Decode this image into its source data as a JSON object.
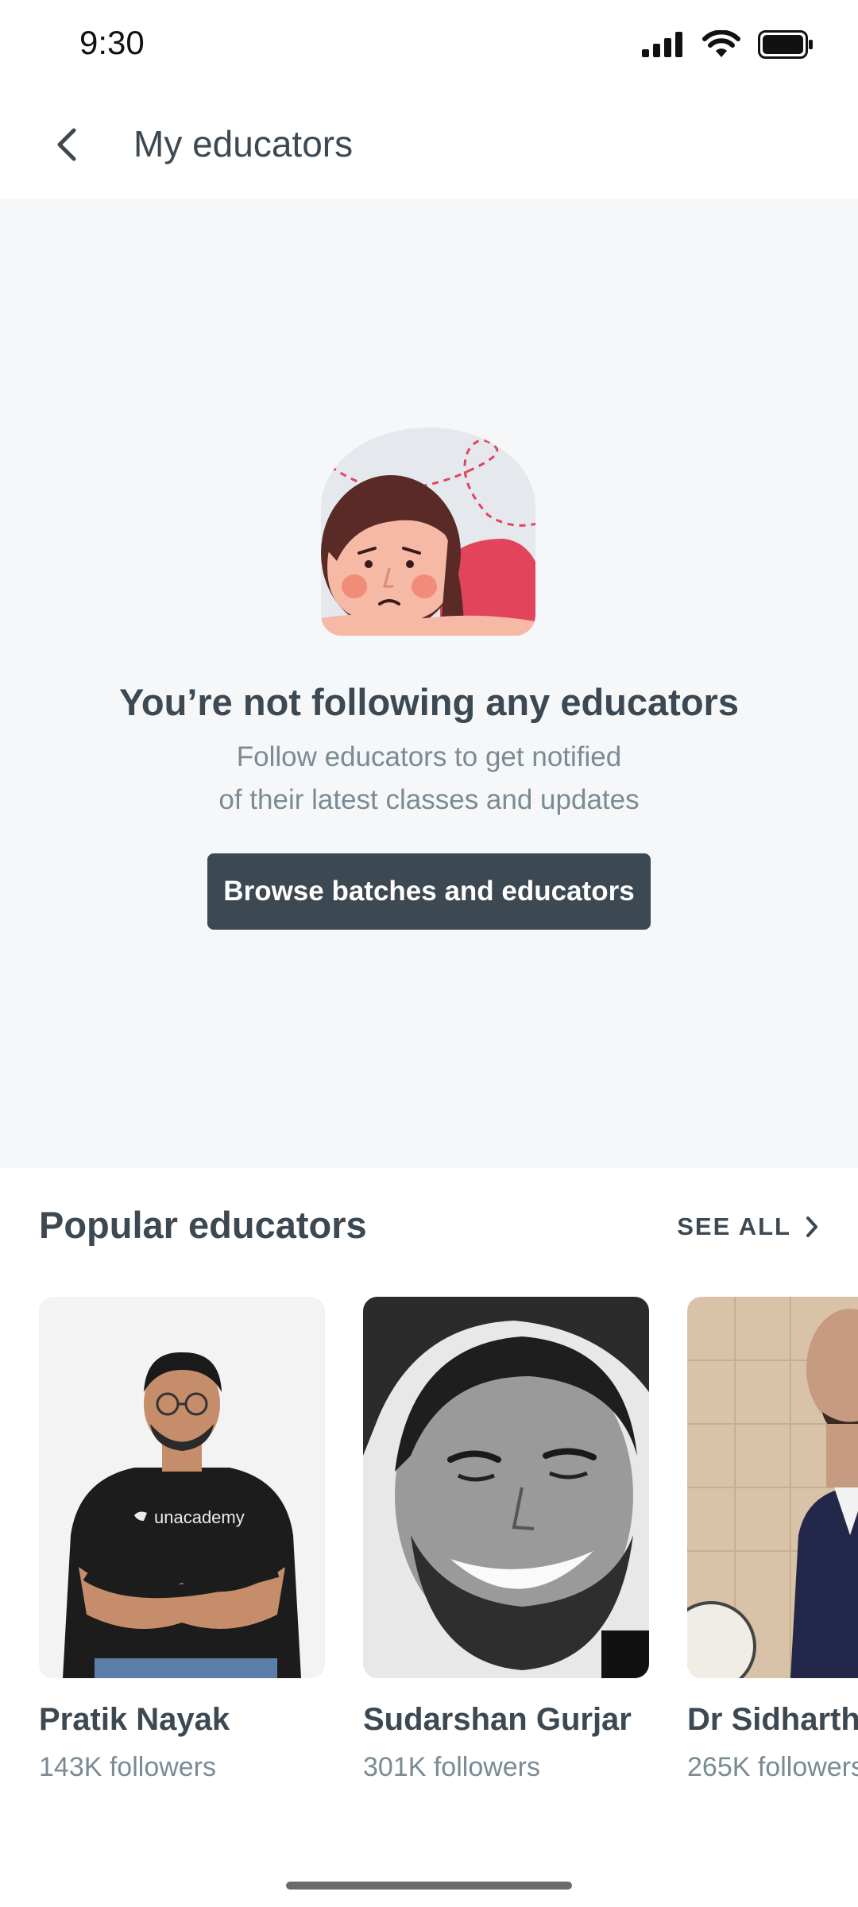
{
  "status_bar": {
    "time": "9:30"
  },
  "header": {
    "title": "My educators"
  },
  "empty_state": {
    "title": "You’re not following any educators",
    "subtitle_line1": "Follow educators to get notified",
    "subtitle_line2": "of their latest classes and updates",
    "button_label": "Browse batches and educators"
  },
  "popular": {
    "title": "Popular educators",
    "see_all": "SEE ALL",
    "educators": [
      {
        "name": "Pratik Nayak",
        "followers": "143K followers",
        "shirt_text": "unacademy"
      },
      {
        "name": "Sudarshan Gurjar",
        "followers": "301K followers"
      },
      {
        "name": "Dr Sidharth",
        "followers": "265K followers"
      }
    ]
  },
  "colors": {
    "primary_dark": "#3c4852",
    "muted_text": "#7a8b94",
    "empty_bg": "#f6f7f9",
    "accent_red": "#e2445c"
  }
}
